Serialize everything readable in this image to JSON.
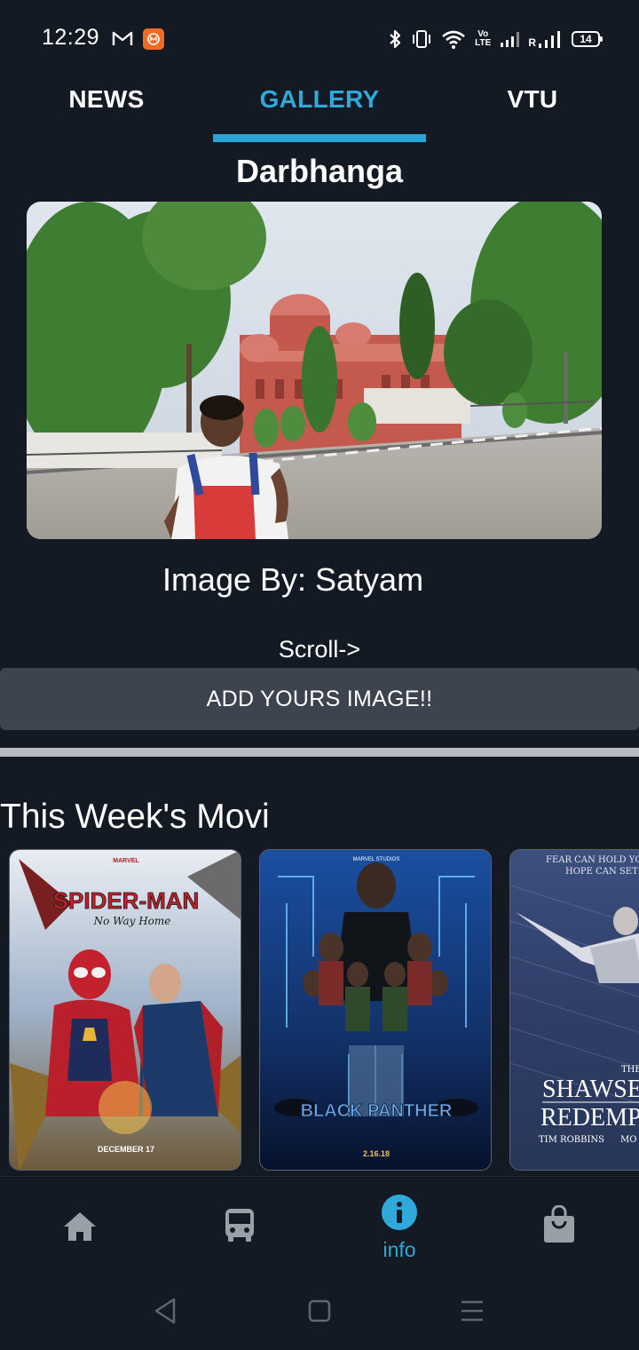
{
  "status_bar": {
    "time": "12:29",
    "battery": "14",
    "volte_top": "Vo",
    "volte_bottom": "LTE",
    "roaming": "R",
    "icons": [
      "gmail-icon",
      "mi-icon",
      "bluetooth-icon",
      "vibrate-icon",
      "wifi-icon",
      "volte-icon",
      "signal-icon",
      "signal-roaming-icon",
      "battery-icon"
    ]
  },
  "tabs": [
    {
      "label": "NEWS",
      "active": false
    },
    {
      "label": "GALLERY",
      "active": true
    },
    {
      "label": "VTU",
      "active": false
    }
  ],
  "colors": {
    "background": "#141a24",
    "accent": "#2ea9d9",
    "button": "#3d4450",
    "divider": "#b8bcc2"
  },
  "gallery": {
    "city": "Darbhanga",
    "image_by": "Image By: Satyam",
    "scroll_hint": "Scroll->",
    "add_button": "ADD YOURS IMAGE!!"
  },
  "movies": {
    "section_title": "This Week's Movi",
    "posters": [
      {
        "title": "SPIDER-MAN",
        "subtitle": "No Way Home",
        "date": "DECEMBER 17",
        "top_text": "MARVEL"
      },
      {
        "title": "BLACK PANTHER",
        "top_text": "MARVEL STUDIOS",
        "date": "2.16.18"
      },
      {
        "title": "THE SHAWSHANK REDEMPTION",
        "title_line1": "THE",
        "title_line2": "SHAWSE",
        "title_line3": "REDEMP",
        "tagline_1": "FEAR CAN HOLD YO",
        "tagline_2": "HOPE CAN SET",
        "cast_1": "TIM ROBBINS",
        "cast_2": "MO"
      }
    ]
  },
  "bottom_nav": [
    {
      "icon": "home-icon",
      "label": ""
    },
    {
      "icon": "bus-icon",
      "label": ""
    },
    {
      "icon": "info-icon",
      "label": "info",
      "active": true
    },
    {
      "icon": "shopping-bag-icon",
      "label": ""
    }
  ],
  "system_nav": [
    "back-icon",
    "home-square-icon",
    "recents-icon"
  ]
}
